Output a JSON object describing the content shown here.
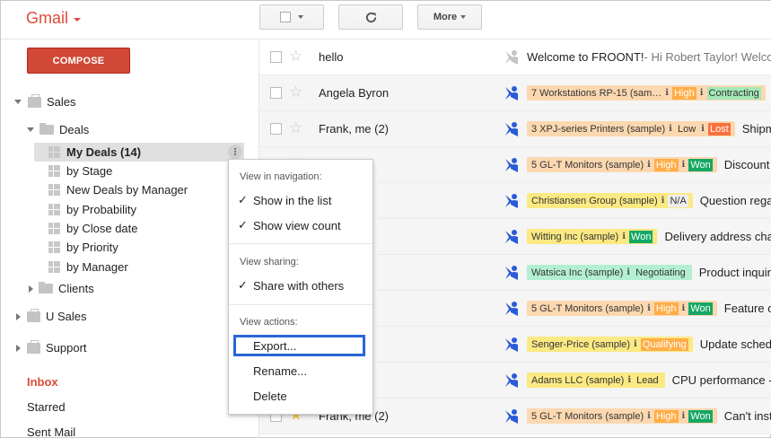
{
  "app": {
    "logo": "Gmail"
  },
  "toolbar": {
    "more_label": "More"
  },
  "compose_label": "COMPOSE",
  "sidebar": {
    "sales": "Sales",
    "deals": "Deals",
    "views": [
      "My Deals (14)",
      "by Stage",
      "New Deals by Manager",
      "by Probability",
      "by Close date",
      "by Priority",
      "by Manager"
    ],
    "clients": "Clients",
    "u_sales": "U Sales",
    "support": "Support",
    "folders": [
      "Inbox",
      "Starred",
      "Sent Mail"
    ]
  },
  "context_menu": {
    "nav_title": "View in navigation:",
    "show_in_list": "Show in the list",
    "show_view_count": "Show view count",
    "sharing_title": "View sharing:",
    "share_with_others": "Share with others",
    "actions_title": "View actions:",
    "export": "Export...",
    "rename": "Rename...",
    "delete": "Delete",
    "check_mark": "✓"
  },
  "emails": [
    {
      "from": "hello",
      "subject": "Welcome to FROONT!",
      "snippet": " - Hi Robert Taylor! Welcome",
      "chip": null
    },
    {
      "from": "Angela Byron",
      "subject": "",
      "snippet": "",
      "chip": {
        "name": "7 Workstations RP-15 (sam…",
        "priority": "High",
        "stage": "Contracting",
        "bg": "#fcd8b0",
        "stage_bg": "#a4e8b8"
      }
    },
    {
      "from": "Frank, me (2)",
      "subject": "Shipment",
      "snippet": "",
      "chip": {
        "name": "3 XPJ-series Printers (sample)",
        "priority": "Low",
        "stage": "Lost",
        "bg": "#fcd8b0",
        "stage_bg": "#f9703f"
      }
    },
    {
      "from": "...is",
      "subject": "Discount",
      "snippet": "",
      "chip": {
        "name": "5 GL-T Monitors (sample)",
        "priority": "High",
        "stage": "Won",
        "bg": "#fcd8b0",
        "stage_bg": "#16a765"
      }
    },
    {
      "from": "...mcrantz",
      "subject": "Question regarding",
      "snippet": "",
      "chip": {
        "name": "Christiansen Group (sample)",
        "priority": "",
        "stage": "N/A",
        "bg": "#fbe983",
        "stage_bg": "#eeeeee"
      }
    },
    {
      "from": "...uk",
      "subject": "Delivery address change",
      "snippet": "",
      "chip": {
        "name": "Witting Inc (sample)",
        "priority": "",
        "stage": "Won",
        "bg": "#fbe983",
        "stage_bg": "#16a765"
      }
    },
    {
      "from": "(2)",
      "subject": "Product inquiry",
      "snippet": "",
      "chip": {
        "name": "Watsica Inc (sample)",
        "priority": "",
        "stage": "Negotiating",
        "bg": "#b3efd3",
        "stage_bg": "#b3efd3"
      }
    },
    {
      "from": "...e (2)",
      "subject": "Feature of",
      "snippet": "",
      "chip": {
        "name": "5 GL-T Monitors (sample)",
        "priority": "High",
        "stage": "Won",
        "bg": "#fcd8b0",
        "stage_bg": "#16a765"
      }
    },
    {
      "from": "...e (2)",
      "subject": "Update schedule",
      "snippet": "",
      "chip": {
        "name": "Senger-Price (sample)",
        "priority": "",
        "stage": "Qualifying",
        "bg": "#fbe983",
        "stage_bg": "#ffad46"
      }
    },
    {
      "from": "2)",
      "subject": "CPU performance -",
      "snippet": "",
      "chip": {
        "name": "Adams LLC (sample)",
        "priority": "",
        "stage": "Lead",
        "bg": "#fbe983",
        "stage_bg": "#fbe983"
      }
    },
    {
      "from": "Frank, me (2)",
      "subject": "Can't install",
      "snippet": "",
      "chip": {
        "name": "5 GL-T Monitors (sample)",
        "priority": "High",
        "stage": "Won",
        "bg": "#fcd8b0",
        "stage_bg": "#16a765"
      }
    }
  ],
  "colors": {
    "accent": "#dd4b39",
    "streak_blue": "#2a5bd7",
    "priority_high": "#ffad46"
  }
}
